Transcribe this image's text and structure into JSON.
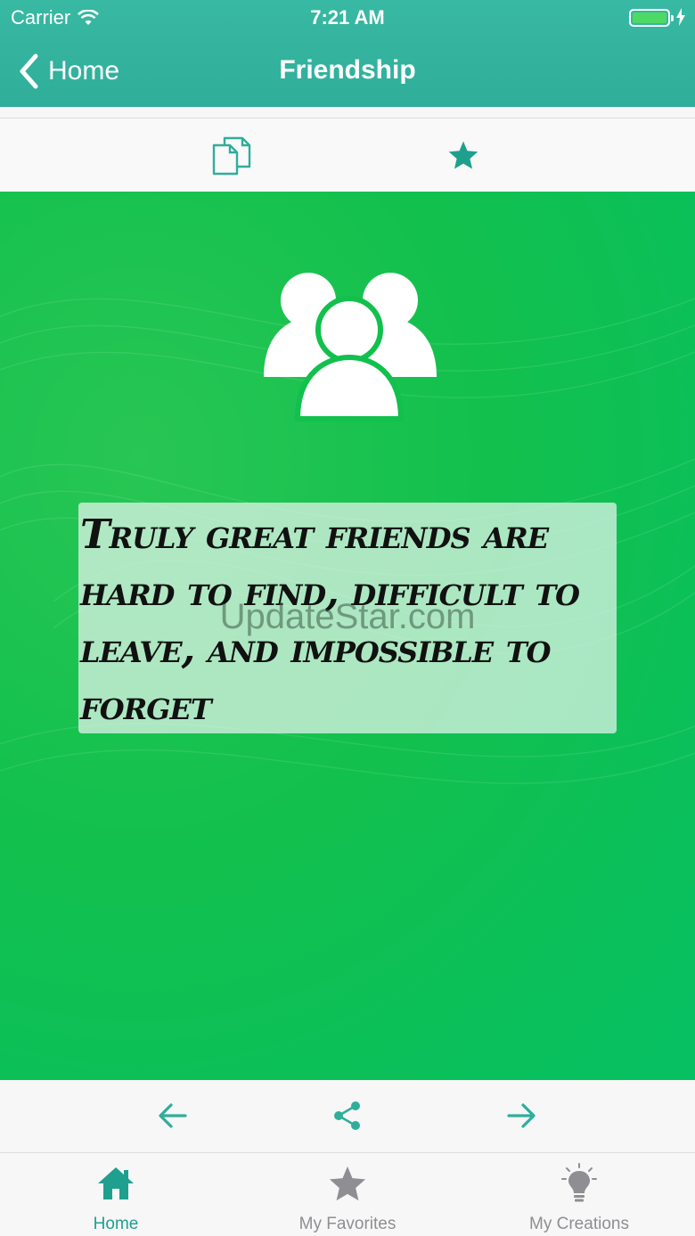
{
  "status_bar": {
    "carrier": "Carrier",
    "time": "7:21 AM"
  },
  "nav": {
    "back_label": "Home",
    "title": "Friendship"
  },
  "toolbar": {
    "icons": [
      "copy-icon",
      "star-icon"
    ]
  },
  "card": {
    "quote": "Truly great friends are hard to find, difficult to leave, and impossible to forget",
    "watermark": "UpdateStar.com",
    "icon": "friends-group-icon"
  },
  "actions": {
    "icons": [
      "arrow-left-icon",
      "share-icon",
      "arrow-right-icon"
    ]
  },
  "tabs": [
    {
      "label": "Home",
      "icon": "home-icon",
      "active": true
    },
    {
      "label": "My Favorites",
      "icon": "star-icon",
      "active": false
    },
    {
      "label": "My Creations",
      "icon": "lightbulb-icon",
      "active": false
    }
  ],
  "colors": {
    "accent": "#2fae9a",
    "card_green": "#0fc050",
    "tab_active": "#1fa08e",
    "tab_inactive": "#8e8e93"
  }
}
